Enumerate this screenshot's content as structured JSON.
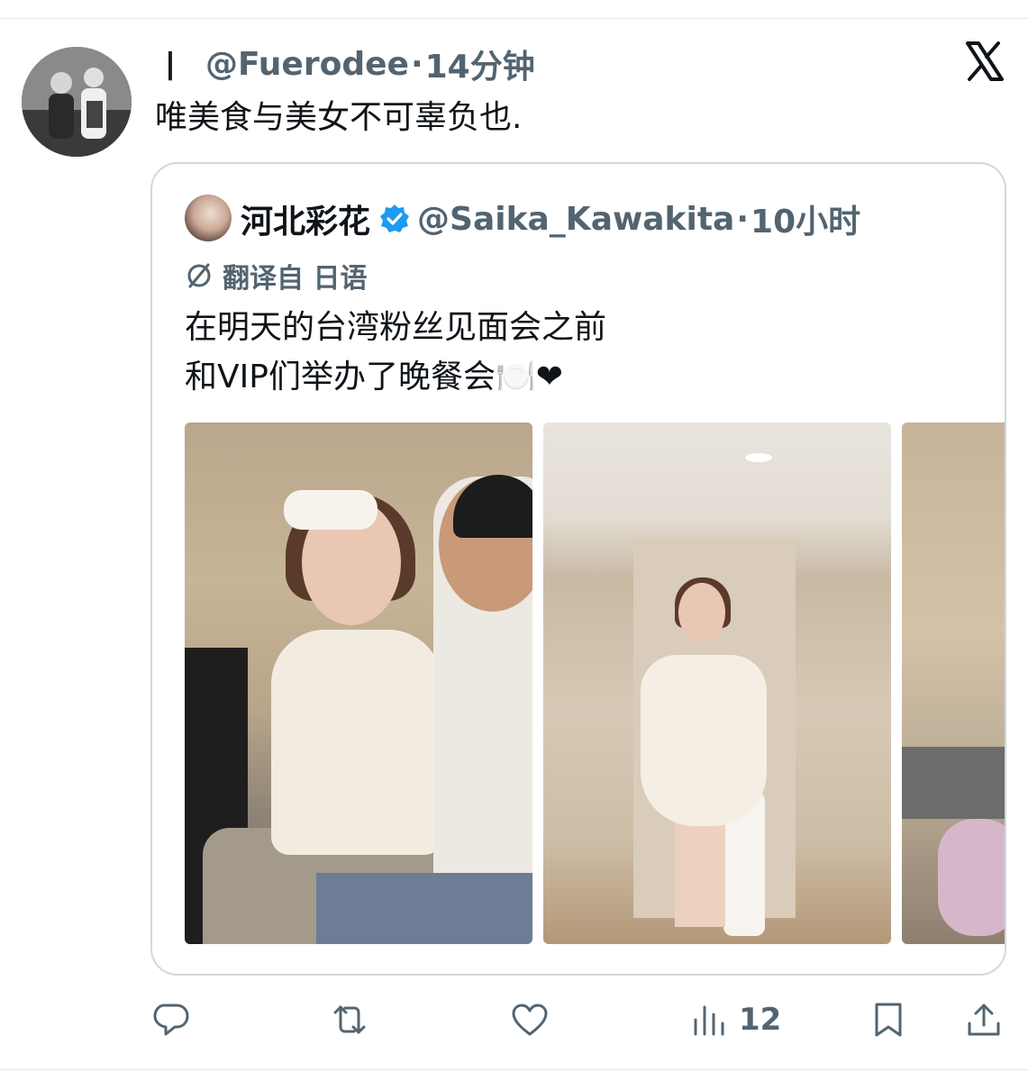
{
  "post": {
    "name_marker": "丨",
    "handle": "@Fuerodee",
    "separator": "·",
    "time": "14分钟",
    "text": "唯美食与美女不可辜负也."
  },
  "quoted": {
    "name": "河北彩花",
    "handle": "@Saika_Kawakita",
    "separator": "·",
    "time": "10小时",
    "translate_label": "翻译自 日语",
    "text_lines": [
      "在明天的台湾粉丝见面会之前",
      "和VIP们举办了晚餐会🍽️❤"
    ]
  },
  "actions": {
    "views": "12"
  },
  "icons": {
    "brand": "x-logo-icon",
    "verified": "verified-badge-icon",
    "translate": "translate-icon",
    "reply": "reply-icon",
    "repost": "repost-icon",
    "like": "like-icon",
    "views": "views-icon",
    "bookmark": "bookmark-icon",
    "share": "share-icon"
  },
  "colors": {
    "text_primary": "#0f1419",
    "text_secondary": "#536471",
    "verified": "#1d9bf0",
    "border": "#cfd9de"
  }
}
